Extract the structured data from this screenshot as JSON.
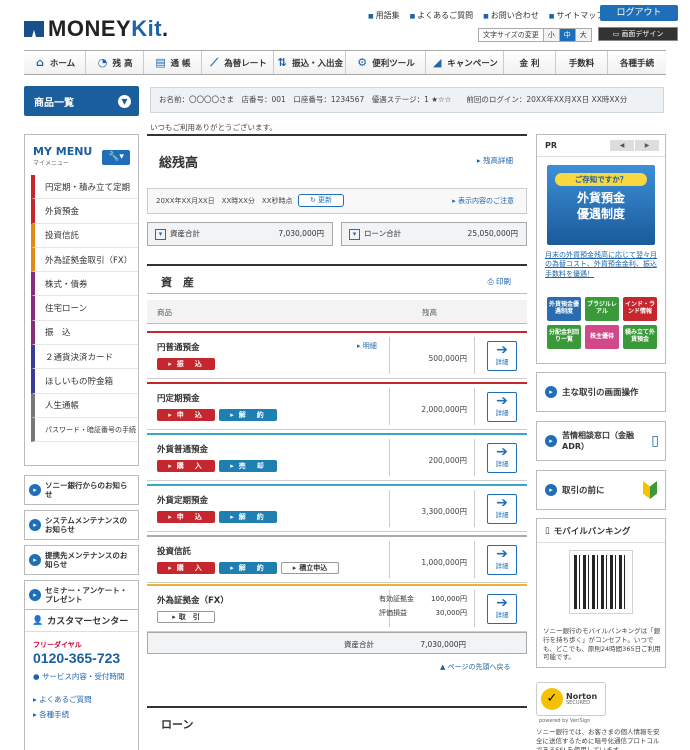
{
  "header": {
    "logo_main": "MONEY",
    "logo_accent": "Kit",
    "logo_suffix": ".",
    "top_links": [
      "用語集",
      "よくあるご質問",
      "お問い合わせ",
      "サイトマップ"
    ],
    "logout_label": "ログアウト",
    "font_size_label": "文字サイズの変更",
    "font_sizes": [
      "小",
      "中",
      "大"
    ],
    "design_label": "画面デザイン"
  },
  "global_nav": [
    {
      "label": "ホーム",
      "icon": "home-icon"
    },
    {
      "label": "残 高",
      "icon": "pie-chart-icon"
    },
    {
      "label": "通 帳",
      "icon": "passbook-icon"
    },
    {
      "label": "為替レート",
      "icon": "line-chart-icon"
    },
    {
      "label": "振込・入出金",
      "icon": "transfer-arrows-icon"
    },
    {
      "label": "便利ツール",
      "icon": "gear-icon"
    },
    {
      "label": "キャンペーン",
      "icon": "megaphone-icon"
    },
    {
      "label": "金 利",
      "icon": ""
    },
    {
      "label": "手数料",
      "icon": ""
    },
    {
      "label": "各種手続",
      "icon": ""
    }
  ],
  "sub_bar": {
    "products_label": "商品一覧",
    "user_info": "お名前：〇〇〇〇さま　店番号：001　口座番号：1234567　優遇ステージ：1 ★☆☆　　前回のログイン：20XX年XX月XX日 XX時XX分",
    "thanks": "いつもご利用ありがとうございます。"
  },
  "my_menu": {
    "title": "MY MENU",
    "subtitle": "マイメニュー",
    "items": [
      {
        "label": "円定期・積み立て定期",
        "color": "#c6262e"
      },
      {
        "label": "外貨預金",
        "color": "#c6262e"
      },
      {
        "label": "投資信託",
        "color": "#e08a18"
      },
      {
        "label": "外為証拠金取引（FX）",
        "color": "#e08a18"
      },
      {
        "label": "株式・債券",
        "color": "#8a2a7a"
      },
      {
        "label": "住宅ローン",
        "color": "#8a2a7a"
      },
      {
        "label": "振　込",
        "color": "#8a2a7a"
      },
      {
        "label": "２通貨決済カード",
        "color": "#3a3a9a"
      },
      {
        "label": "ほしいもの貯金箱",
        "color": "#3a3a9a"
      },
      {
        "label": "人生通帳",
        "color": "#777777"
      },
      {
        "label": "パスワード・暗証番号の手続",
        "color": "#777777"
      }
    ]
  },
  "info_links": [
    "ソニー銀行からのお知らせ",
    "システムメンテナンスのお知らせ",
    "提携先メンテナンスのお知らせ",
    "セミナー・アンケート・プレゼント"
  ],
  "customer_center": {
    "title": "カスタマーセンター",
    "free_dial_label": "フリーダイヤル",
    "phone": "0120-365-723",
    "links": [
      "サービス内容・受付時間",
      "よくあるご質問",
      "各種手続"
    ]
  },
  "summary": {
    "title": "総残高",
    "detail_link": "残高詳細",
    "as_of": "20XX年XX月XX日　XX時XX分　XX秒時点",
    "update_label": "更新",
    "display_note": "表示内容のご注意",
    "asset_total_label": "資産合計",
    "asset_total_value": "7,030,000円",
    "loan_total_label": "ローン合計",
    "loan_total_value": "25,050,000円"
  },
  "assets": {
    "title": "資　産",
    "print_label": "印刷",
    "col_product": "商品",
    "col_balance": "残高",
    "rows": [
      {
        "name": "円普通預金",
        "balance": "500,000円",
        "color": "#c6262e",
        "buttons": [
          [
            "振　込",
            "red"
          ]
        ],
        "sublink": "明細",
        "detail": "詳細"
      },
      {
        "name": "円定期預金",
        "balance": "2,000,000円",
        "color": "#c6262e",
        "buttons": [
          [
            "申　込",
            "red"
          ],
          [
            "解　約",
            "blue"
          ]
        ],
        "detail": "詳細"
      },
      {
        "name": "外貨普通預金",
        "balance": "200,000円",
        "color": "#3aa7c9",
        "buttons": [
          [
            "購　入",
            "red"
          ],
          [
            "売　却",
            "blue"
          ]
        ],
        "detail": "詳細"
      },
      {
        "name": "外貨定期預金",
        "balance": "3,300,000円",
        "color": "#3aa7c9",
        "buttons": [
          [
            "申　込",
            "red"
          ],
          [
            "解　約",
            "blue"
          ]
        ],
        "detail": "詳細"
      },
      {
        "name": "投資信託",
        "balance": "1,000,000円",
        "color": "#aaaaaa",
        "buttons": [
          [
            "購　入",
            "red"
          ],
          [
            "解　約",
            "blue"
          ],
          [
            "積立申込",
            "wht"
          ]
        ],
        "detail": "詳細"
      },
      {
        "name": "外為証拠金（FX）",
        "balance": "",
        "color": "#e8b630",
        "buttons": [
          [
            "取　引",
            "wht"
          ]
        ],
        "detail": "詳細",
        "fx": {
          "eff_label": "有効証拠金",
          "eff_value": "100,000円",
          "val_label": "評価損益",
          "val_value": "30,000円"
        }
      }
    ],
    "total_label": "資産合計",
    "total_value": "7,030,000円",
    "go_top": "ページの先頭へ戻る"
  },
  "loan": {
    "title": "ローン"
  },
  "right": {
    "pr_label": "PR",
    "pr_prev": "◀",
    "pr_next": "▶",
    "ad_question": "ご存知ですか？",
    "ad_title": "外貨預金\n優遇制度",
    "ad_desc": "月末の外貨預金残高に応じて翌々月の為替コスト、外貨預金金利、振込手数料を優遇！",
    "tiles": [
      {
        "label": "外貨預金優遇制度",
        "color": "#2b6cb0"
      },
      {
        "label": "ブラジルレアル",
        "color": "#3a9a3a"
      },
      {
        "label": "インド・ランド情報",
        "color": "#c6262e"
      },
      {
        "label": "分配金利回り一覧",
        "color": "#3a9a3a"
      },
      {
        "label": "株主優待",
        "color": "#d04a8a"
      },
      {
        "label": "積み立て外貨預金",
        "color": "#3a9a3a"
      }
    ],
    "boxes": [
      "主な取引の画面操作",
      "苦情相談窓口（金融ADR）",
      "取引の前に"
    ],
    "mobile_title": "モバイルバンキング",
    "mobile_text": "ソニー銀行のモバイルバンキングは「銀行を持ち歩く」がコンセプト。いつでも、どこでも、原則24時間365日ご利用可能です。",
    "norton_name": "Norton",
    "norton_sub": "SECURED",
    "norton_by": "powered by VeriSign",
    "norton_text": "ソニー銀行では、お客さまの個人情報を安全に送信するために暗号化通信プロトコルであるSSLを使用しています。"
  }
}
